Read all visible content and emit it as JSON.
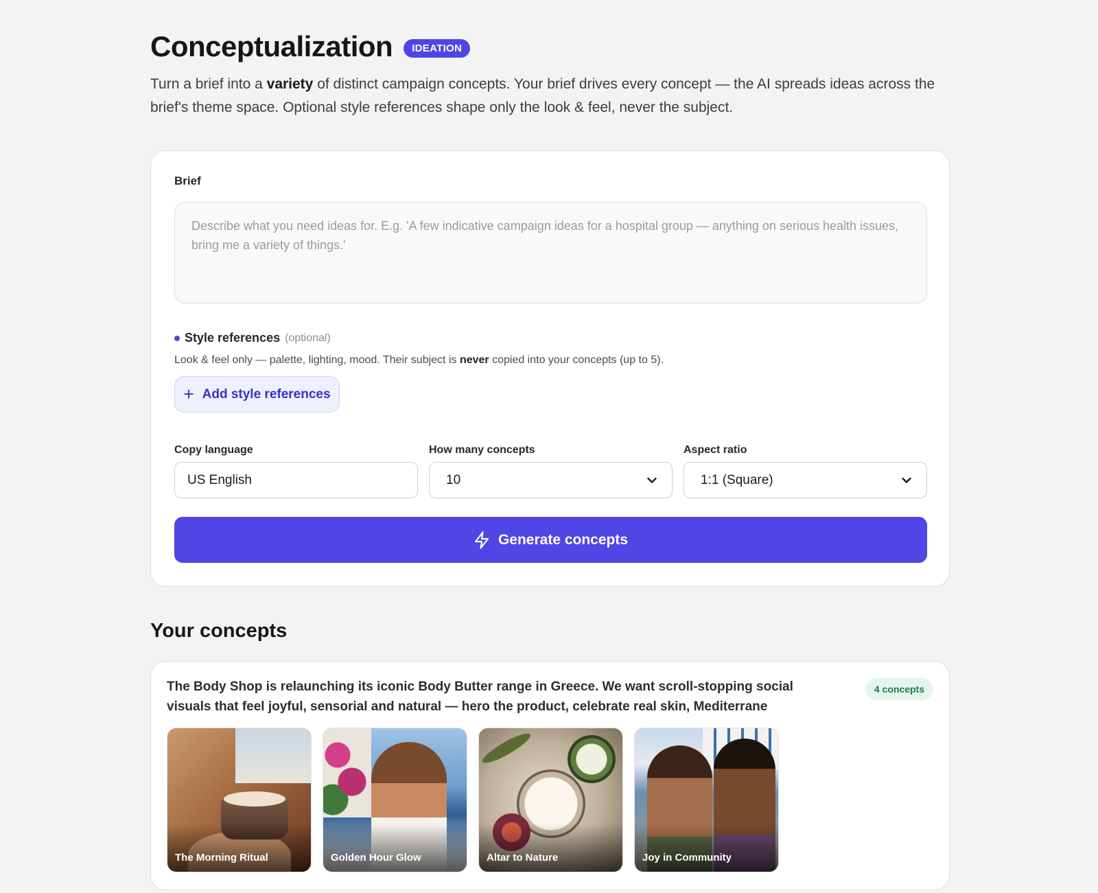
{
  "header": {
    "title": "Conceptualization",
    "badge": "IDEATION",
    "intro_pre": "Turn a brief into a ",
    "intro_bold": "variety",
    "intro_post": " of distinct campaign concepts. Your brief drives every concept — the AI spreads ideas across the brief's theme space. Optional style references shape only the look & feel, never the subject."
  },
  "form": {
    "brief_label": "Brief",
    "brief_placeholder": "Describe what you need ideas for. E.g. 'A few indicative campaign ideas for a hospital group — anything on serious health issues, bring me a variety of things.'",
    "brief_value": "",
    "style_title": "Style references",
    "style_optional": "(optional)",
    "style_desc_pre": "Look & feel only — palette, lighting, mood. Their subject is ",
    "style_desc_bold": "never",
    "style_desc_post": " copied into your concepts (up to 5).",
    "add_style_label": "Add style references",
    "copy_language_label": "Copy language",
    "copy_language_value": "US English",
    "concept_count_label": "How many concepts",
    "concept_count_value": "10",
    "aspect_ratio_label": "Aspect ratio",
    "aspect_ratio_value": "1:1 (Square)",
    "generate_label": "Generate concepts"
  },
  "concepts": {
    "heading": "Your concepts",
    "groups": [
      {
        "brief": "The Body Shop is relaunching its iconic Body Butter range in Greece. We want scroll-stopping social visuals that feel joyful, sensorial and natural — hero the product, celebrate real skin, Mediterrane",
        "count_label": "4 concepts",
        "items": [
          {
            "title": "The Morning Ritual"
          },
          {
            "title": "Golden Hour Glow"
          },
          {
            "title": "Altar to Nature"
          },
          {
            "title": "Joy in Community"
          }
        ]
      }
    ]
  },
  "colors": {
    "accent": "#4f46e5",
    "background": "#f3f3f4",
    "count_badge_bg": "#e5f5ee",
    "count_badge_text": "#1e7a4e"
  }
}
